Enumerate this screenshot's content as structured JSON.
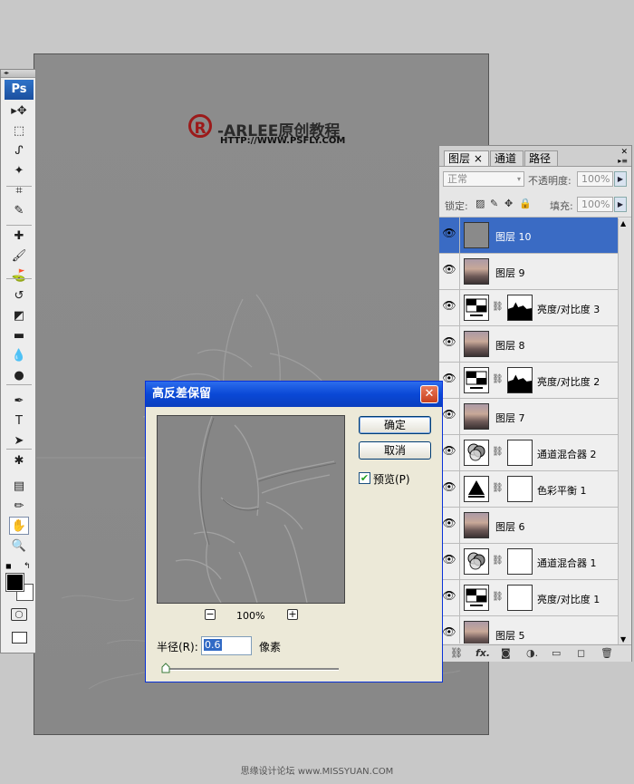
{
  "watermark": {
    "logo_symbol": "R",
    "brand_text": "-ARLEE原创教程",
    "url": "HTTP://WWW.PSFLY.COM"
  },
  "toolbox": {
    "grip": "◂▸",
    "logo": "Ps",
    "tools": [
      {
        "name": "move-tool-icon",
        "glyph": "▸✥"
      },
      {
        "name": "marquee-tool-icon",
        "glyph": "⬚"
      },
      {
        "name": "lasso-tool-icon",
        "glyph": "ᔑ"
      },
      {
        "name": "magic-wand-tool-icon",
        "glyph": "✦"
      },
      {
        "name": "crop-tool-icon",
        "glyph": "⌗"
      },
      {
        "name": "slice-tool-icon",
        "glyph": "✎"
      },
      {
        "name": "healing-brush-tool-icon",
        "glyph": "✚"
      },
      {
        "name": "brush-tool-icon",
        "glyph": "🖌"
      },
      {
        "name": "clone-stamp-tool-icon",
        "glyph": "⛳"
      },
      {
        "name": "history-brush-tool-icon",
        "glyph": "↺"
      },
      {
        "name": "eraser-tool-icon",
        "glyph": "◩"
      },
      {
        "name": "gradient-tool-icon",
        "glyph": "▬"
      },
      {
        "name": "blur-tool-icon",
        "glyph": "💧"
      },
      {
        "name": "dodge-tool-icon",
        "glyph": "●"
      },
      {
        "name": "pen-tool-icon",
        "glyph": "✒"
      },
      {
        "name": "type-tool-icon",
        "glyph": "T"
      },
      {
        "name": "path-selection-tool-icon",
        "glyph": "➤"
      },
      {
        "name": "shape-tool-icon",
        "glyph": "✱"
      },
      {
        "name": "notes-tool-icon",
        "glyph": "▤"
      },
      {
        "name": "eyedropper-tool-icon",
        "glyph": "✏"
      },
      {
        "name": "hand-tool-icon",
        "glyph": "✋"
      },
      {
        "name": "zoom-tool-icon",
        "glyph": "🔍"
      }
    ]
  },
  "layers_panel": {
    "tabs": [
      "图层 ×",
      "通道",
      "路径"
    ],
    "blend_mode": "正常",
    "opacity_label": "不透明度:",
    "opacity_value": "100%",
    "lock_label": "锁定:",
    "fill_label": "填充:",
    "fill_value": "100%",
    "layers": [
      {
        "name": "图层 10",
        "thumb": "gray",
        "mask": null,
        "selected": true
      },
      {
        "name": "图层 9",
        "thumb": "photo",
        "mask": null,
        "selected": false
      },
      {
        "name": "亮度/对比度 3",
        "thumb": "adj",
        "mask": "black-partial",
        "selected": false
      },
      {
        "name": "图层 8",
        "thumb": "photo",
        "mask": null,
        "selected": false
      },
      {
        "name": "亮度/对比度 2",
        "thumb": "adj",
        "mask": "black-partial",
        "selected": false
      },
      {
        "name": "图层 7",
        "thumb": "photo",
        "mask": null,
        "selected": false
      },
      {
        "name": "通道混合器 2",
        "thumb": "adj",
        "mask": "white",
        "selected": false
      },
      {
        "name": "色彩平衡 1",
        "thumb": "adj",
        "mask": "white",
        "selected": false
      },
      {
        "name": "图层 6",
        "thumb": "photo",
        "mask": null,
        "selected": false
      },
      {
        "name": "通道混合器 1",
        "thumb": "adj",
        "mask": "white",
        "selected": false
      },
      {
        "name": "亮度/对比度 1",
        "thumb": "adj",
        "mask": "white",
        "selected": false
      },
      {
        "name": "图层 5",
        "thumb": "photo",
        "mask": null,
        "selected": false
      }
    ]
  },
  "dialog": {
    "title": "高反差保留",
    "ok_label": "确定",
    "cancel_label": "取消",
    "preview_label": "预览(P)",
    "zoom_value": "100%",
    "radius_label": "半径(R):",
    "radius_value": "0.6",
    "unit": "像素"
  },
  "footer": {
    "text": "思缘设计论坛 www.MISSYUAN.COM"
  }
}
